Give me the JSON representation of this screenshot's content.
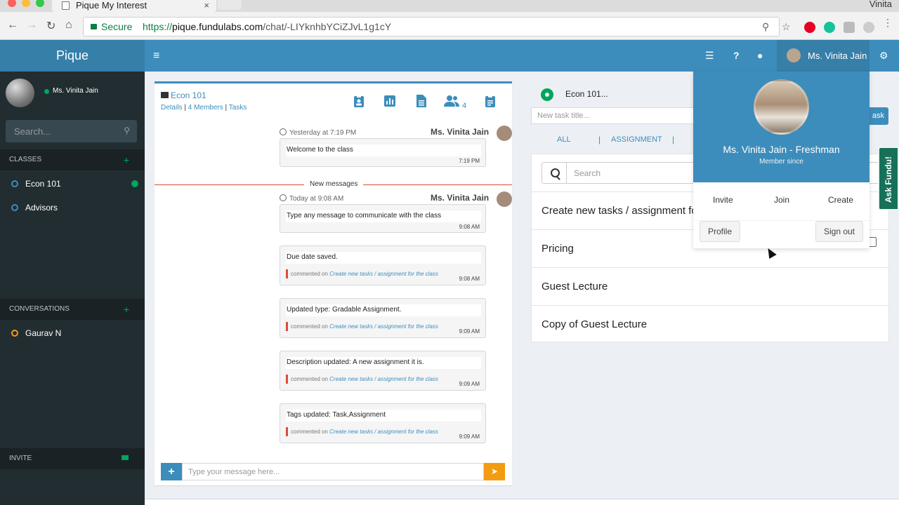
{
  "browser": {
    "tab_title": "Pique My Interest",
    "tab_close": "×",
    "os_user": "Vinita",
    "secure_label": "Secure",
    "url_scheme": "https://",
    "url_host": "pique.fundulabs.com",
    "url_path": "/chat/-LIYknhbYCiZJvL1g1cY",
    "back": "←",
    "forward": "→",
    "reload": "↻",
    "home": "⌂",
    "zoom_icon": "⚲",
    "star_icon": "☆"
  },
  "header": {
    "logo": "Pique",
    "hamburger": "≡",
    "icons": [
      "list-icon",
      "help-icon",
      "comments-icon"
    ],
    "help": "?",
    "user_name": "Ms. Vinita Jain",
    "settings_icon": "⚙"
  },
  "sidebar": {
    "user_name": "Ms. Vinita Jain",
    "search_placeholder": "Search...",
    "search_icon": "⚲",
    "classes_header": "CLASSES",
    "plus": "+",
    "classes": [
      {
        "label": "Econ 101",
        "active": true
      },
      {
        "label": "Advisors",
        "active": false
      }
    ],
    "conversations_header": "CONVERSATIONS",
    "conversations": [
      {
        "label": "Gaurav N"
      }
    ],
    "invite_header": "INVITE"
  },
  "chat": {
    "title": "Econ 101",
    "links": {
      "details": "Details",
      "members": "4 Members",
      "tasks": "Tasks",
      "sep": "|"
    },
    "member_count": "4",
    "tool_icons": [
      "clipboard-user-icon",
      "bar-chart-icon",
      "document-icon",
      "group-icon",
      "clipboard-list-icon"
    ],
    "new_messages_label": "New messages",
    "messages": [
      {
        "meta": "Yesterday at 7:19 PM",
        "author": "Ms. Vinita Jain",
        "text": "Welcome to the class",
        "time": "7:19 PM"
      },
      {
        "meta": "Today at 9:08 AM",
        "author": "Ms. Vinita Jain",
        "text": "Type any message to communicate with the class",
        "time": "9:08 AM"
      },
      {
        "text": "Due date saved.",
        "comment_prefix": "commented on",
        "comment_link": "Create new tasks / assignment for the class",
        "time": "9:08 AM"
      },
      {
        "text": "Updated type: Gradable Assignment.",
        "comment_prefix": "commented on",
        "comment_link": "Create new tasks / assignment for the class",
        "time": "9:09 AM"
      },
      {
        "text": "Description updated: A new assignment it is.",
        "comment_prefix": "commented on",
        "comment_link": "Create new tasks / assignment for the class",
        "time": "9:09 AM"
      },
      {
        "text": "Tags updated: Task,Assignment",
        "comment_prefix": "commented on",
        "comment_link": "Create new tasks / assignment for the class",
        "time": "9:09 AM"
      }
    ],
    "input_placeholder": "Type your message here...",
    "add_label": "+",
    "send_icon": "➤"
  },
  "tasks": {
    "class_label": "Econ 101...",
    "new_task_placeholder": "New task title...",
    "add_task_label": "ask",
    "tabs": [
      "ALL",
      "ASSIGNMENT"
    ],
    "tab_sep": "|",
    "search_placeholder": "Search",
    "items": [
      "Create new tasks / assignment for the class",
      "Pricing",
      "Guest Lecture",
      "Copy of Guest Lecture"
    ]
  },
  "dropdown": {
    "name_line": "Ms. Vinita Jain - Freshman",
    "member_since": "Member since",
    "links": [
      "Invite",
      "Join",
      "Create"
    ],
    "profile_label": "Profile",
    "signout_label": "Sign out"
  },
  "ask_fundu": "Ask Fundu!",
  "colors": {
    "primary": "#3c8dbc",
    "sidebar": "#222d32",
    "accent_green": "#00a65a",
    "accent_orange": "#f39c12",
    "danger": "#dd4b39"
  }
}
